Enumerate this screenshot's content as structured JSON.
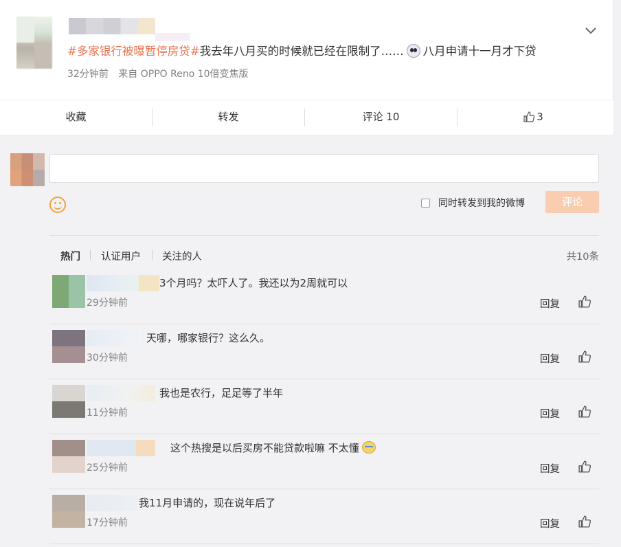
{
  "post": {
    "topic": "#多家银行被曝暂停房贷#",
    "text_before_emoji": "我去年八月买的时候就已经在限制了……",
    "text_after_emoji": "八月申请十一月才下贷",
    "time": "32分钟前",
    "source": "来自 OPPO Reno 10倍变焦版"
  },
  "actions": {
    "favorite": "收藏",
    "repost": "转发",
    "comment": "评论 10",
    "like_count": "3"
  },
  "composer": {
    "input_value": "",
    "repost_label": "同时转发到我的微博",
    "submit_label": "评论"
  },
  "filters": {
    "tabs": [
      "热门",
      "认证用户",
      "关注的人"
    ],
    "total": "共10条"
  },
  "comments": [
    {
      "text": "3个月吗？太吓人了。我还以为2周就可以",
      "time": "29分钟前",
      "reply": "回复"
    },
    {
      "text": "天哪，哪家银行？这么久。",
      "time": "30分钟前",
      "reply": "回复"
    },
    {
      "text": "我也是农行，足足等了半年",
      "time": "11分钟前",
      "reply": "回复"
    },
    {
      "text": "这个热搜是以后买房不能贷款啦嘛 不太懂",
      "time": "25分钟前",
      "reply": "回复"
    },
    {
      "text": "我11月申请的，现在说年后了",
      "time": "17分钟前",
      "reply": "回复"
    }
  ],
  "colors": {
    "topic": "#eb7350",
    "submit_disabled": "#fbcdb0",
    "background": "#f2f2f5"
  }
}
